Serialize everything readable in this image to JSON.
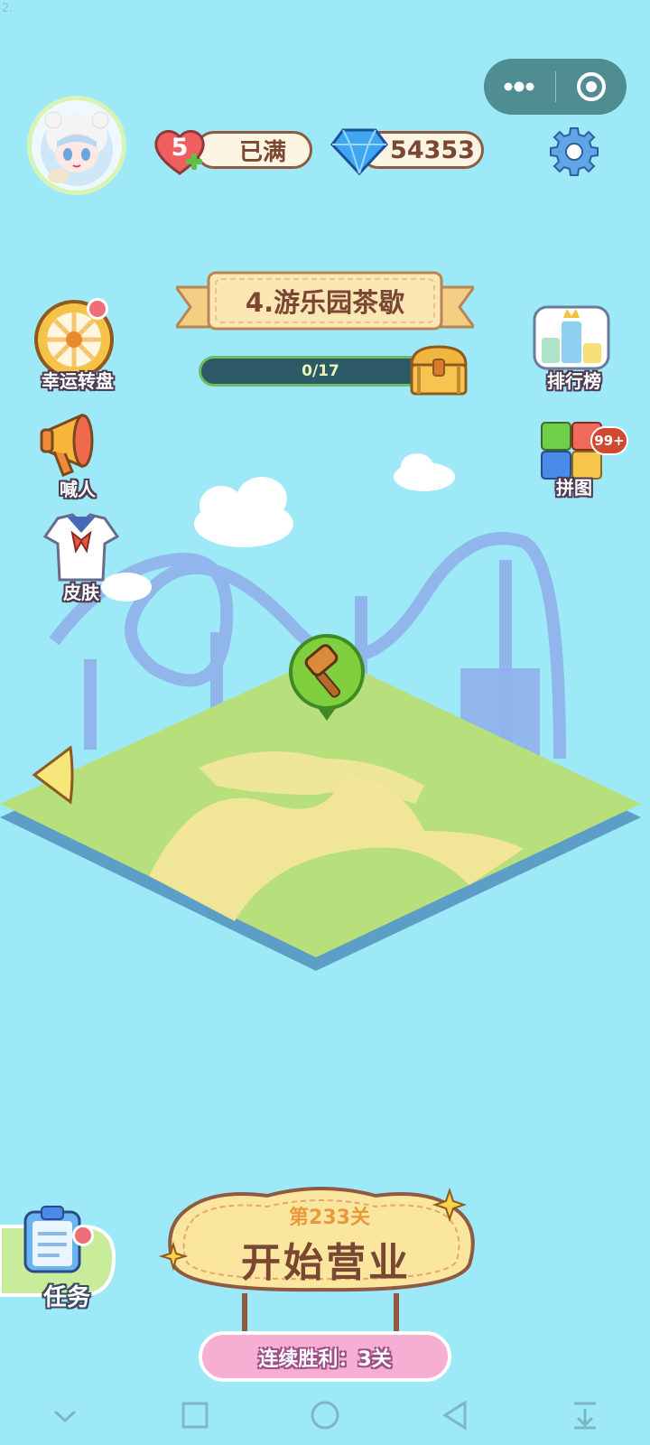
{
  "corner_label": "2.",
  "capsule": {
    "menu_icon": "more-dots-icon",
    "close_icon": "target-circle-icon"
  },
  "header": {
    "lives_count": "5",
    "lives_status": "已满",
    "gems": "54353"
  },
  "level": {
    "title": "4.游乐园茶歇",
    "progress_text": "0/17",
    "progress_fraction": 0
  },
  "left_menu": [
    {
      "label": "幸运转盘",
      "icon": "lucky-wheel-icon",
      "has_dot": true
    },
    {
      "label": "喊人",
      "icon": "megaphone-icon",
      "has_dot": false
    },
    {
      "label": "皮肤",
      "icon": "outfit-icon",
      "has_dot": false
    }
  ],
  "right_menu": [
    {
      "label": "排行榜",
      "icon": "leaderboard-icon"
    },
    {
      "label": "拼图",
      "icon": "puzzle-icon",
      "badge": "99+"
    }
  ],
  "start": {
    "level_label": "第233关",
    "button_label": "开始营业",
    "streak_label": "连续胜利：3关"
  },
  "task": {
    "label": "任务"
  },
  "colors": {
    "sky": "#9ee9f7",
    "grass": "#b7e07c",
    "sand": "#f3e59a",
    "brown": "#7a4732"
  }
}
